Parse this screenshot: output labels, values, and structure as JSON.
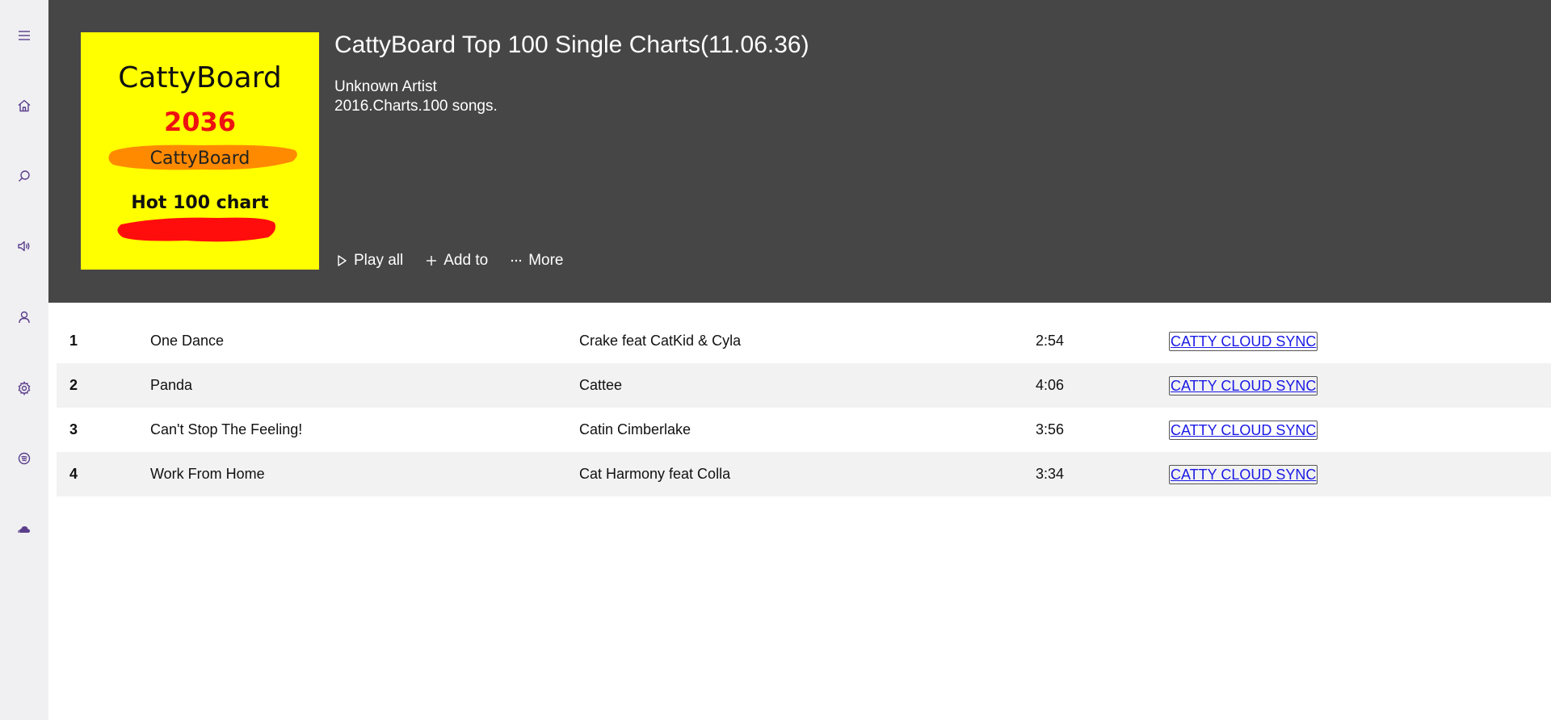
{
  "sidebar": {
    "items": [
      {
        "icon": "menu-icon"
      },
      {
        "icon": "home-icon"
      },
      {
        "icon": "search-icon"
      },
      {
        "icon": "speaker-icon"
      },
      {
        "icon": "user-icon"
      },
      {
        "icon": "gear-icon"
      },
      {
        "icon": "spotify-icon"
      },
      {
        "icon": "soundcloud-icon"
      }
    ],
    "icon_color": "#5a3e8c"
  },
  "album": {
    "title": "CattyBoard Top 100 Single Charts(11.06.36)",
    "artist": "Unknown Artist",
    "description": "2016.Charts.100 songs.",
    "cover": {
      "brand": "CattyBoard",
      "year": "2036",
      "subbrand": "CattyBoard",
      "tagline": "Hot 100 chart",
      "background": "#ffff00"
    }
  },
  "actions": {
    "play_all": "Play all",
    "add_to": "Add to",
    "more": "More"
  },
  "tracks": [
    {
      "num": "1",
      "title": "One Dance",
      "artist": "Crake feat CatKid & Cyla",
      "duration": "2:54",
      "sync": "CATTY CLOUD SYNC"
    },
    {
      "num": "2",
      "title": "Panda",
      "artist": "Cattee",
      "duration": "4:06",
      "sync": "CATTY CLOUD SYNC"
    },
    {
      "num": "3",
      "title": "Can't Stop The Feeling!",
      "artist": "Catin Cimberlake",
      "duration": "3:56",
      "sync": "CATTY CLOUD SYNC"
    },
    {
      "num": "4",
      "title": "Work From Home",
      "artist": "Cat Harmony feat Colla",
      "duration": "3:34",
      "sync": "CATTY CLOUD SYNC"
    }
  ],
  "colors": {
    "header_bg": "#464646",
    "sidebar_bg": "#f0f0f2",
    "row_alt_bg": "#f2f2f2",
    "link": "#1a1ae6"
  }
}
